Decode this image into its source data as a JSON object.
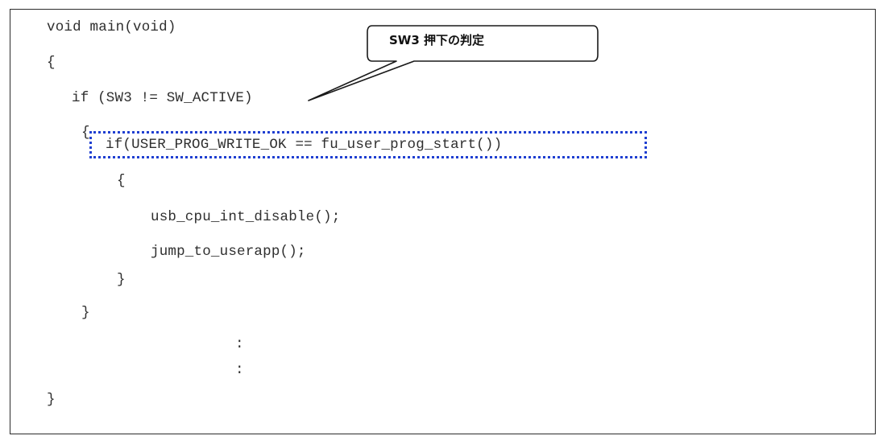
{
  "code": {
    "lines": [
      "void main(void)",
      "{",
      "if (SW3 != SW_ACTIVE)",
      "{",
      "if(USER_PROG_WRITE_OK == fu_user_prog_start())",
      "{",
      "usb_cpu_int_disable();",
      "jump_to_userapp();",
      "}",
      "}",
      ":",
      ":",
      "}"
    ]
  },
  "callout": {
    "text": "SW3 押下の判定"
  },
  "colors": {
    "highlight_border": "#1f3fd1",
    "frame_border": "#2b2b2b",
    "code_text": "#2f2f2f"
  }
}
